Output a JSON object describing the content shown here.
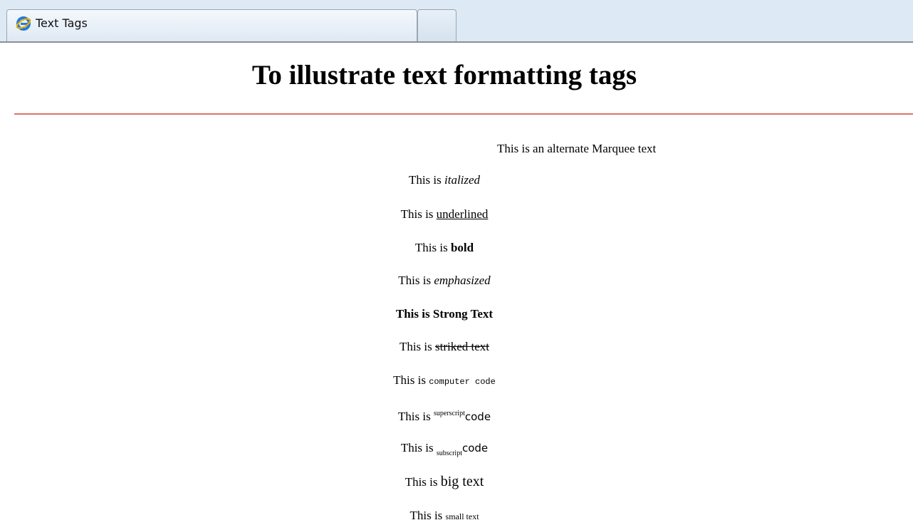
{
  "tab": {
    "title": "Text Tags",
    "icon": "ie-browser-icon"
  },
  "page": {
    "heading": "To illustrate text formatting tags",
    "marquee": "This is an alternate Marquee text",
    "prefix": "This is ",
    "lines": {
      "italic": "italized",
      "underline": "underlined",
      "bold": "bold",
      "emphasis": "emphasized",
      "strong": "Strong Text",
      "strike": "striked text",
      "code": "computer code",
      "superscript": "superscript",
      "superscript_after": "code",
      "subscript": "subscript",
      "subscript_after": "code",
      "big": "big text",
      "small": "small text"
    }
  },
  "colors": {
    "tabbar_bg": "#dde9f5",
    "rule": "#e07066"
  }
}
